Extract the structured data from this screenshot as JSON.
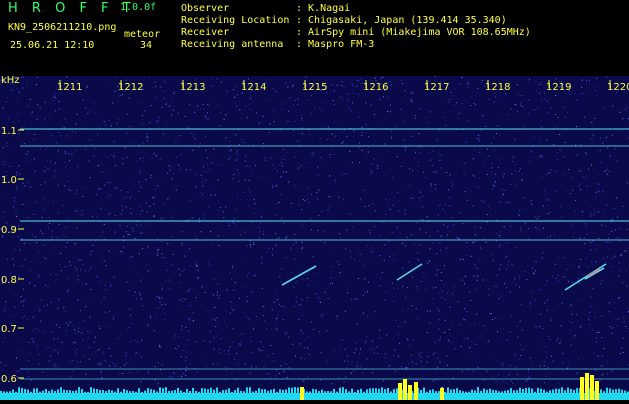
{
  "header": {
    "logo": "H R O F F T",
    "version": "1.0.0f",
    "filename": "KN9_2506211210.png",
    "datetime": "25.06.21 12:10",
    "meteor_label": "meteor",
    "meteor_count": "34"
  },
  "info": {
    "observer_label": "Observer",
    "observer_value": ": K.Nagai",
    "location_label": "Receiving Location",
    "location_value": ": Chigasaki, Japan (139.414 35.340)",
    "receiver_label": "Receiver",
    "receiver_value": ": AirSpy mini (Miakejima VOR 108.65MHz)",
    "antenna_label": "Receiving antenna",
    "antenna_value": ": Maspro FM-3"
  },
  "plot": {
    "y_unit": "kHz",
    "y_ticks": [
      "1.1",
      "1.0",
      "0.9",
      "0.8",
      "0.7",
      "0.6"
    ],
    "x_ticks": [
      "1211",
      "1212",
      "1213",
      "1214",
      "1215",
      "1216",
      "1217",
      "1218",
      "1219",
      "1220"
    ],
    "colors": {
      "background": "#0a0a4a",
      "noise": "#2a3cc8",
      "tick_text": "#ffff40",
      "carrier": "#5ad8e8",
      "spectrum": "#20d8f0",
      "spectrum_peak": "#ffff20"
    }
  }
}
